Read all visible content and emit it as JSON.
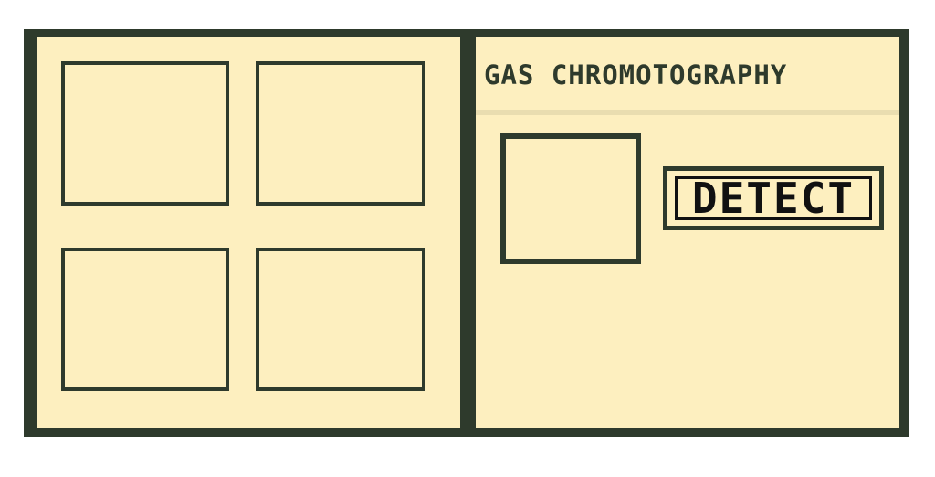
{
  "title": "GAS CHROMOTOGRAPHY",
  "detect_button": {
    "label": "DETECT"
  },
  "colors": {
    "background": "#fdefbf",
    "border": "#2e3a2c",
    "text": "#111111"
  }
}
